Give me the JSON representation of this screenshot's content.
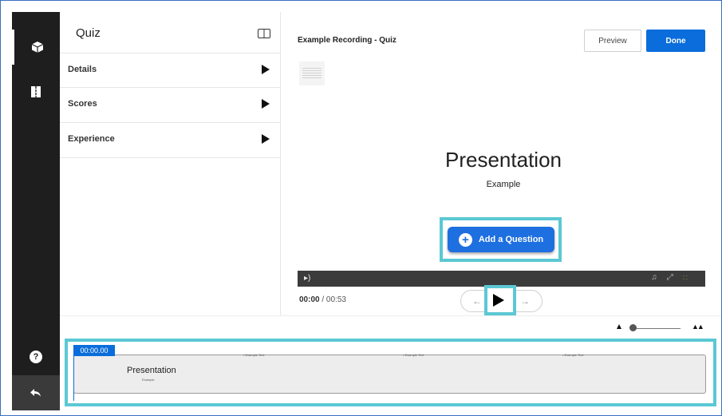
{
  "rail": {
    "top_icons": [
      "cube-icon",
      "book-icon"
    ],
    "bottom_icons": [
      "help-icon",
      "back-arrow-icon"
    ],
    "help_label": "?"
  },
  "quiz_panel": {
    "title": "Quiz",
    "toggle_icon": "panel-toggle-icon",
    "items": [
      {
        "label": "Details"
      },
      {
        "label": "Scores"
      },
      {
        "label": "Experience"
      }
    ]
  },
  "header": {
    "recording_title": "Example Recording - Quiz",
    "preview_label": "Preview",
    "done_label": "Done"
  },
  "slide": {
    "title": "Presentation",
    "subtitle": "Example"
  },
  "add_question": {
    "label": "Add a Question",
    "icon": "plus-icon"
  },
  "player": {
    "current_time": "00:00",
    "separator": " / ",
    "total_time": "00:53",
    "icons": [
      "volume-icon",
      "music-icon",
      "fullscreen-icon",
      "captions-icon"
    ]
  },
  "timeline": {
    "timestamp": "00:00.00",
    "marker_label": "• Example Text",
    "clip_title": "Presentation",
    "clip_subtitle": "Example"
  },
  "colors": {
    "accent": "#0a6ddb",
    "highlight": "#5bc8d4",
    "rail": "#1e1e1e"
  }
}
